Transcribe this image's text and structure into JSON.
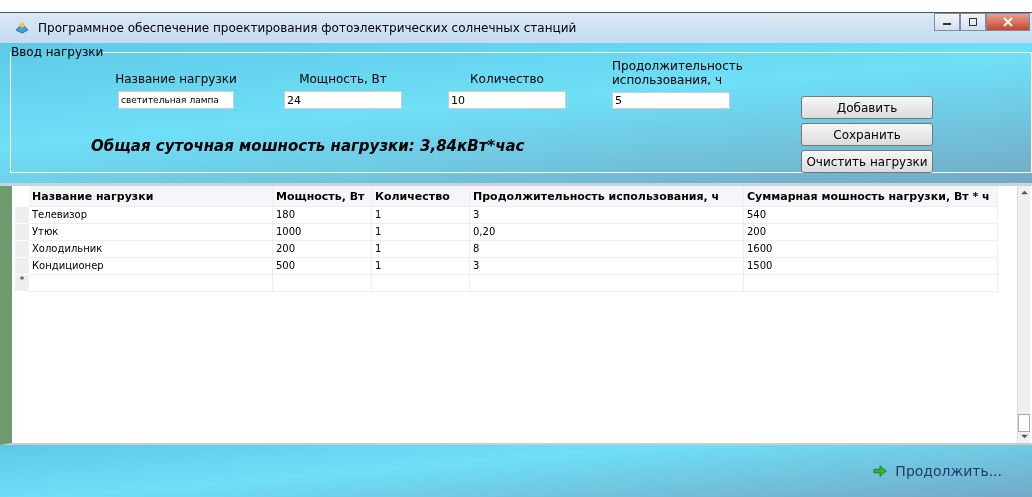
{
  "window": {
    "title": "Программное обеспечение проектирования фотоэлектрических солнечных станций"
  },
  "input_group": {
    "title": "Ввод нагрузки",
    "fields": [
      {
        "label": "Название нагрузки",
        "value": "светительная лампа"
      },
      {
        "label": "Мощность, Вт",
        "value": "24"
      },
      {
        "label": "Количество",
        "value": "10"
      },
      {
        "label": "Продолжительность использования, ч",
        "value": "5"
      }
    ],
    "total": "Общая суточная мошность нагрузки: 3,84кВт*час",
    "buttons": [
      "Добавить",
      "Сохранить",
      "Очистить нагрузки"
    ]
  },
  "table": {
    "columns": [
      "Название нагрузки",
      "Мощность, Вт",
      "Количество",
      "Продолжительность использования, ч",
      "Суммарная мошность нагрузки, Вт * ч"
    ],
    "rows": [
      [
        "Телевизор",
        "180",
        "1",
        "3",
        "540"
      ],
      [
        "Утюк",
        "1000",
        "1",
        "0,20",
        "200"
      ],
      [
        "Холодильник",
        "200",
        "1",
        "8",
        "1600"
      ],
      [
        "Кондиционер",
        "500",
        "1",
        "3",
        "1500"
      ]
    ],
    "new_row_marker": "*"
  },
  "continue_button": "Продолжить..."
}
